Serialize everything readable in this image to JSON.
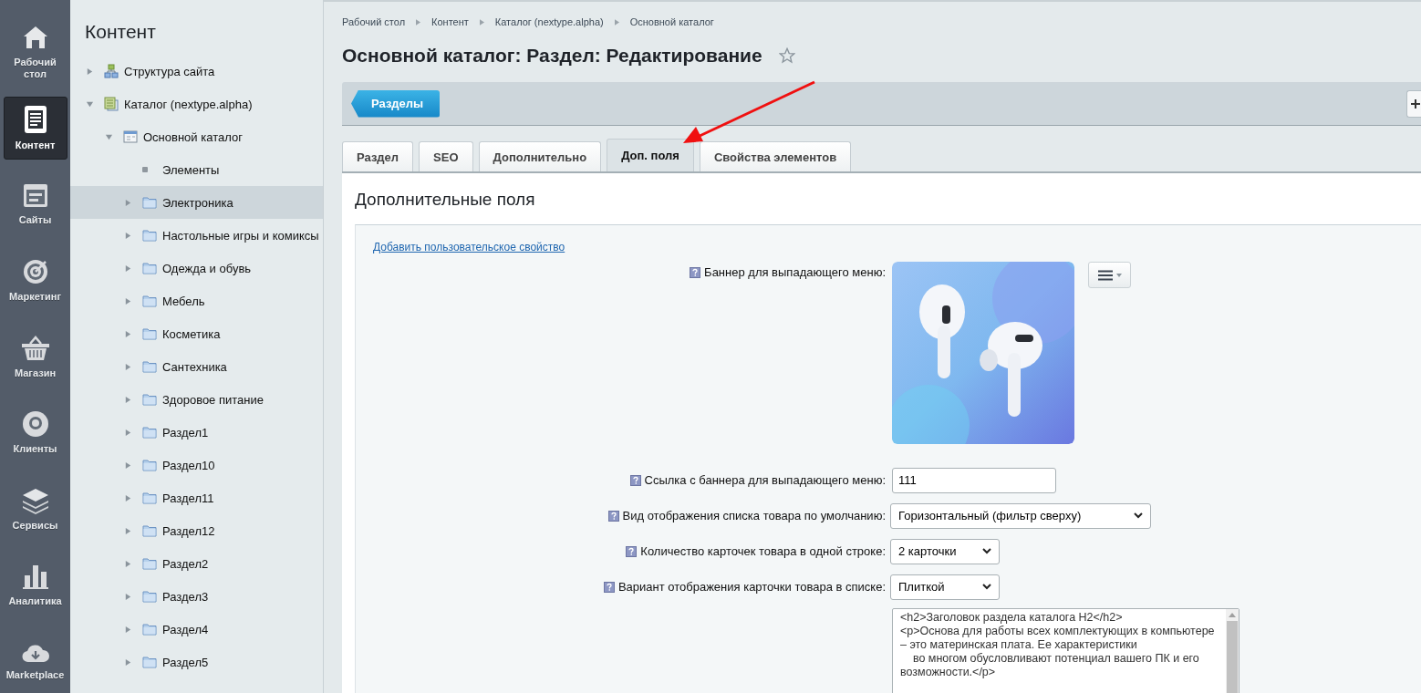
{
  "nav": [
    {
      "kind": "home",
      "label": "Рабочий стол",
      "selected": false
    },
    {
      "kind": "content",
      "label": "Контент",
      "selected": true
    },
    {
      "kind": "sites",
      "label": "Сайты",
      "selected": false
    },
    {
      "kind": "marketing",
      "label": "Маркетинг",
      "selected": false
    },
    {
      "kind": "shop",
      "label": "Магазин",
      "selected": false
    },
    {
      "kind": "clients",
      "label": "Клиенты",
      "selected": false
    },
    {
      "kind": "services",
      "label": "Сервисы",
      "selected": false
    },
    {
      "kind": "analytics",
      "label": "Аналитика",
      "selected": false
    },
    {
      "kind": "marketplace",
      "label": "Marketplace",
      "selected": false
    }
  ],
  "sidebar": {
    "title": "Контент",
    "tree": [
      {
        "kind": "structure",
        "label": "Структура сайта",
        "expanded": false,
        "selected": false
      },
      {
        "kind": "catalog",
        "label": "Каталог (nextype.alpha)",
        "expanded": true,
        "selected": false,
        "children": [
          {
            "kind": "iblock",
            "label": "Основной каталог",
            "expanded": true,
            "selected": false,
            "children": [
              {
                "kind": "leaf",
                "label": "Элементы",
                "selected": false
              },
              {
                "kind": "folder",
                "label": "Электроника",
                "expanded": false,
                "selected": true
              },
              {
                "kind": "folder",
                "label": "Настольные игры и комиксы",
                "expanded": false,
                "selected": false
              },
              {
                "kind": "folder",
                "label": "Одежда и обувь",
                "expanded": false,
                "selected": false
              },
              {
                "kind": "folder",
                "label": "Мебель",
                "expanded": false,
                "selected": false
              },
              {
                "kind": "folder",
                "label": "Косметика",
                "expanded": false,
                "selected": false
              },
              {
                "kind": "folder",
                "label": "Сантехника",
                "expanded": false,
                "selected": false
              },
              {
                "kind": "folder",
                "label": "Здоровое питание",
                "expanded": false,
                "selected": false
              },
              {
                "kind": "folder",
                "label": "Раздел1",
                "expanded": false,
                "selected": false
              },
              {
                "kind": "folder",
                "label": "Раздел10",
                "expanded": false,
                "selected": false
              },
              {
                "kind": "folder",
                "label": "Раздел11",
                "expanded": false,
                "selected": false
              },
              {
                "kind": "folder",
                "label": "Раздел12",
                "expanded": false,
                "selected": false
              },
              {
                "kind": "folder",
                "label": "Раздел2",
                "expanded": false,
                "selected": false
              },
              {
                "kind": "folder",
                "label": "Раздел3",
                "expanded": false,
                "selected": false
              },
              {
                "kind": "folder",
                "label": "Раздел4",
                "expanded": false,
                "selected": false
              },
              {
                "kind": "folder",
                "label": "Раздел5",
                "expanded": false,
                "selected": false
              }
            ]
          }
        ]
      }
    ]
  },
  "breadcrumbs": [
    "Рабочий стол",
    "Контент",
    "Каталог (nextype.alpha)",
    "Основной каталог"
  ],
  "page_title": "Основной каталог: Раздел: Редактирование",
  "toolbar": {
    "back_button": "Разделы"
  },
  "tabs": [
    {
      "label": "Раздел",
      "selected": false
    },
    {
      "label": "SEO",
      "selected": false
    },
    {
      "label": "Дополнительно",
      "selected": false
    },
    {
      "label": "Доп. поля",
      "selected": true
    },
    {
      "label": "Свойства элементов",
      "selected": false
    }
  ],
  "panel": {
    "title": "Дополнительные поля",
    "add_link": "Добавить пользовательское свойство",
    "fields": [
      {
        "label": "Баннер для выпадающего меню:"
      },
      {
        "kind": "text",
        "label": "Ссылка с баннера для выпадающего меню:",
        "value": "111"
      },
      {
        "kind": "select",
        "label": "Вид отображения списка товара по умолчанию:",
        "value": "Горизонтальный (фильтр сверху)",
        "wide": true
      },
      {
        "kind": "select",
        "label": "Количество карточек товара в одной строке:",
        "value": "2 карточки",
        "wide": false
      },
      {
        "kind": "select",
        "label": "Вариант отображения карточки товара в списке:",
        "value": "Плиткой",
        "wide": false
      },
      {
        "kind": "textarea",
        "value": "<h2>Заголовок раздела каталога H2</h2>\n<p>Основа для работы всех комплектующих в компьютере – это материнская плата. Ее характеристики\n    во многом обусловливают потенциал вашего ПК и его возможности.</p>"
      }
    ]
  }
}
